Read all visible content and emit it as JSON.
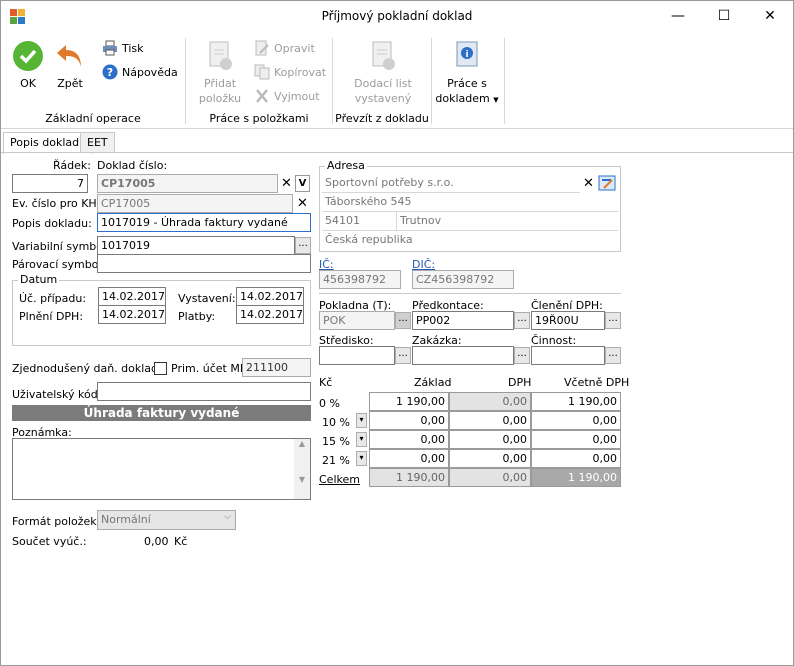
{
  "window": {
    "title": "Příjmový pokladní doklad",
    "minimize": "—",
    "maximize": "☐",
    "close": "✕"
  },
  "ribbon": {
    "ok": "OK",
    "back": "Zpět",
    "print": "Tisk",
    "help": "Nápověda",
    "group_basic": "Základní operace",
    "add_item_1": "Přidat",
    "add_item_2": "položku",
    "edit": "Opravit",
    "copy": "Kopírovat",
    "cut": "Vyjmout",
    "group_items": "Práce s položkami",
    "delivery_1": "Dodací list",
    "delivery_2": "vystavený",
    "group_take": "Převzít z dokladu",
    "doc_work_1": "Práce s",
    "doc_work_2": "dokladem"
  },
  "tabs": [
    "Popis dokladu",
    "EET"
  ],
  "form": {
    "row_label": "Řádek:",
    "row_value": "7",
    "docnum_label": "Doklad číslo:",
    "docnum_value": "CP17005",
    "ev_label": "Ev. číslo pro KH:",
    "ev_value": "CP17005",
    "desc_label": "Popis dokladu:",
    "desc_value": "1017019 - Úhrada faktury vydané",
    "varsym_label": "Variabilní symbol:",
    "varsym_value": "1017019",
    "parsym_label": "Párovací symbol:",
    "parsym_value": "",
    "date_group": "Datum",
    "uc_label": "Úč. případu:",
    "uc_value": "14.02.2017",
    "vyst_label": "Vystavení:",
    "vyst_value": "14.02.2017",
    "dph_label": "Plnění DPH:",
    "dph_value": "14.02.2017",
    "platby_label": "Platby:",
    "platby_value": "14.02.2017",
    "zjed_label": "Zjednodušený daň. doklad:",
    "prim_label": "Prim. účet MD:",
    "prim_value": "211100",
    "user_label": "Uživatelský kód:",
    "user_value": "",
    "banner": "Úhrada faktury vydané",
    "note_label": "Poznámka:",
    "note_value": "",
    "format_label": "Formát položek:",
    "format_value": "Normální",
    "sum_label": "Součet vyúč.:",
    "sum_value": "0,00",
    "sum_unit": "Kč"
  },
  "address": {
    "group": "Adresa",
    "name": "Sportovní potřeby s.r.o.",
    "street": "Táborského 545",
    "zip": "54101",
    "city": "Trutnov",
    "country": "Česká republika",
    "ic_label": "IČ:",
    "ic_value": "456398792",
    "dic_label": "DIČ:",
    "dic_value": "CZ456398792"
  },
  "accounting": {
    "pokladna_label": "Pokladna (T):",
    "pokladna_value": "POK",
    "predkontace_label": "Předkontace:",
    "predkontace_value": "PP002",
    "cleneni_label": "Členění DPH:",
    "cleneni_value": "19Ř00U",
    "stredisko_label": "Středisko:",
    "stredisko_value": "",
    "zakazka_label": "Zakázka:",
    "zakazka_value": "",
    "cinnost_label": "Činnost:",
    "cinnost_value": ""
  },
  "vat_table": {
    "headers": {
      "currency": "Kč",
      "base": "Základ",
      "vat": "DPH",
      "total": "Včetně DPH"
    },
    "rows": [
      {
        "rate": "0 %",
        "base": "1 190,00",
        "vat": "0,00",
        "total": "1 190,00"
      },
      {
        "rate": "10 %",
        "base": "0,00",
        "vat": "0,00",
        "total": "0,00"
      },
      {
        "rate": "15 %",
        "base": "0,00",
        "vat": "0,00",
        "total": "0,00"
      },
      {
        "rate": "21 %",
        "base": "0,00",
        "vat": "0,00",
        "total": "0,00"
      }
    ],
    "total": {
      "label": "Celkem",
      "base": "1 190,00",
      "vat": "0,00",
      "total": "1 190,00"
    }
  }
}
